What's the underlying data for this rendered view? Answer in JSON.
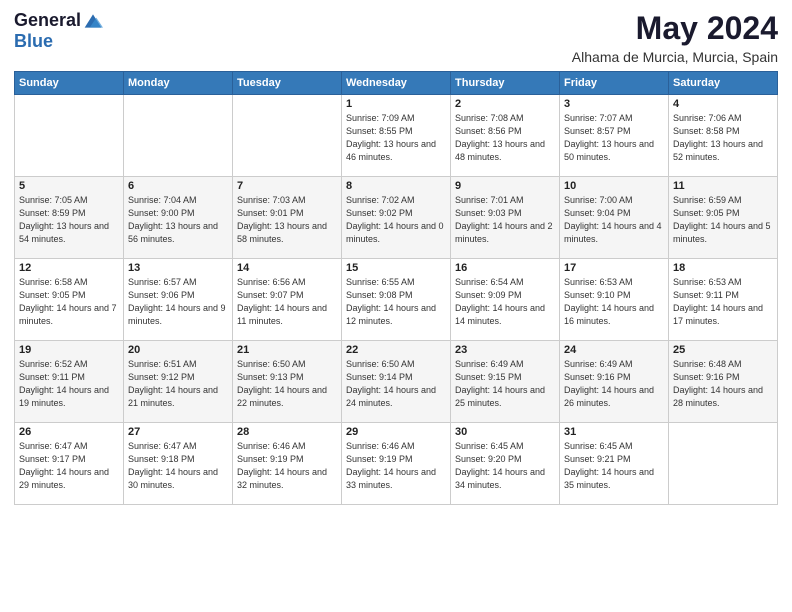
{
  "logo": {
    "general": "General",
    "blue": "Blue"
  },
  "header": {
    "title": "May 2024",
    "subtitle": "Alhama de Murcia, Murcia, Spain"
  },
  "weekdays": [
    "Sunday",
    "Monday",
    "Tuesday",
    "Wednesday",
    "Thursday",
    "Friday",
    "Saturday"
  ],
  "weeks": [
    [
      {
        "day": "",
        "sunrise": "",
        "sunset": "",
        "daylight": ""
      },
      {
        "day": "",
        "sunrise": "",
        "sunset": "",
        "daylight": ""
      },
      {
        "day": "",
        "sunrise": "",
        "sunset": "",
        "daylight": ""
      },
      {
        "day": "1",
        "sunrise": "Sunrise: 7:09 AM",
        "sunset": "Sunset: 8:55 PM",
        "daylight": "Daylight: 13 hours and 46 minutes."
      },
      {
        "day": "2",
        "sunrise": "Sunrise: 7:08 AM",
        "sunset": "Sunset: 8:56 PM",
        "daylight": "Daylight: 13 hours and 48 minutes."
      },
      {
        "day": "3",
        "sunrise": "Sunrise: 7:07 AM",
        "sunset": "Sunset: 8:57 PM",
        "daylight": "Daylight: 13 hours and 50 minutes."
      },
      {
        "day": "4",
        "sunrise": "Sunrise: 7:06 AM",
        "sunset": "Sunset: 8:58 PM",
        "daylight": "Daylight: 13 hours and 52 minutes."
      }
    ],
    [
      {
        "day": "5",
        "sunrise": "Sunrise: 7:05 AM",
        "sunset": "Sunset: 8:59 PM",
        "daylight": "Daylight: 13 hours and 54 minutes."
      },
      {
        "day": "6",
        "sunrise": "Sunrise: 7:04 AM",
        "sunset": "Sunset: 9:00 PM",
        "daylight": "Daylight: 13 hours and 56 minutes."
      },
      {
        "day": "7",
        "sunrise": "Sunrise: 7:03 AM",
        "sunset": "Sunset: 9:01 PM",
        "daylight": "Daylight: 13 hours and 58 minutes."
      },
      {
        "day": "8",
        "sunrise": "Sunrise: 7:02 AM",
        "sunset": "Sunset: 9:02 PM",
        "daylight": "Daylight: 14 hours and 0 minutes."
      },
      {
        "day": "9",
        "sunrise": "Sunrise: 7:01 AM",
        "sunset": "Sunset: 9:03 PM",
        "daylight": "Daylight: 14 hours and 2 minutes."
      },
      {
        "day": "10",
        "sunrise": "Sunrise: 7:00 AM",
        "sunset": "Sunset: 9:04 PM",
        "daylight": "Daylight: 14 hours and 4 minutes."
      },
      {
        "day": "11",
        "sunrise": "Sunrise: 6:59 AM",
        "sunset": "Sunset: 9:05 PM",
        "daylight": "Daylight: 14 hours and 5 minutes."
      }
    ],
    [
      {
        "day": "12",
        "sunrise": "Sunrise: 6:58 AM",
        "sunset": "Sunset: 9:05 PM",
        "daylight": "Daylight: 14 hours and 7 minutes."
      },
      {
        "day": "13",
        "sunrise": "Sunrise: 6:57 AM",
        "sunset": "Sunset: 9:06 PM",
        "daylight": "Daylight: 14 hours and 9 minutes."
      },
      {
        "day": "14",
        "sunrise": "Sunrise: 6:56 AM",
        "sunset": "Sunset: 9:07 PM",
        "daylight": "Daylight: 14 hours and 11 minutes."
      },
      {
        "day": "15",
        "sunrise": "Sunrise: 6:55 AM",
        "sunset": "Sunset: 9:08 PM",
        "daylight": "Daylight: 14 hours and 12 minutes."
      },
      {
        "day": "16",
        "sunrise": "Sunrise: 6:54 AM",
        "sunset": "Sunset: 9:09 PM",
        "daylight": "Daylight: 14 hours and 14 minutes."
      },
      {
        "day": "17",
        "sunrise": "Sunrise: 6:53 AM",
        "sunset": "Sunset: 9:10 PM",
        "daylight": "Daylight: 14 hours and 16 minutes."
      },
      {
        "day": "18",
        "sunrise": "Sunrise: 6:53 AM",
        "sunset": "Sunset: 9:11 PM",
        "daylight": "Daylight: 14 hours and 17 minutes."
      }
    ],
    [
      {
        "day": "19",
        "sunrise": "Sunrise: 6:52 AM",
        "sunset": "Sunset: 9:11 PM",
        "daylight": "Daylight: 14 hours and 19 minutes."
      },
      {
        "day": "20",
        "sunrise": "Sunrise: 6:51 AM",
        "sunset": "Sunset: 9:12 PM",
        "daylight": "Daylight: 14 hours and 21 minutes."
      },
      {
        "day": "21",
        "sunrise": "Sunrise: 6:50 AM",
        "sunset": "Sunset: 9:13 PM",
        "daylight": "Daylight: 14 hours and 22 minutes."
      },
      {
        "day": "22",
        "sunrise": "Sunrise: 6:50 AM",
        "sunset": "Sunset: 9:14 PM",
        "daylight": "Daylight: 14 hours and 24 minutes."
      },
      {
        "day": "23",
        "sunrise": "Sunrise: 6:49 AM",
        "sunset": "Sunset: 9:15 PM",
        "daylight": "Daylight: 14 hours and 25 minutes."
      },
      {
        "day": "24",
        "sunrise": "Sunrise: 6:49 AM",
        "sunset": "Sunset: 9:16 PM",
        "daylight": "Daylight: 14 hours and 26 minutes."
      },
      {
        "day": "25",
        "sunrise": "Sunrise: 6:48 AM",
        "sunset": "Sunset: 9:16 PM",
        "daylight": "Daylight: 14 hours and 28 minutes."
      }
    ],
    [
      {
        "day": "26",
        "sunrise": "Sunrise: 6:47 AM",
        "sunset": "Sunset: 9:17 PM",
        "daylight": "Daylight: 14 hours and 29 minutes."
      },
      {
        "day": "27",
        "sunrise": "Sunrise: 6:47 AM",
        "sunset": "Sunset: 9:18 PM",
        "daylight": "Daylight: 14 hours and 30 minutes."
      },
      {
        "day": "28",
        "sunrise": "Sunrise: 6:46 AM",
        "sunset": "Sunset: 9:19 PM",
        "daylight": "Daylight: 14 hours and 32 minutes."
      },
      {
        "day": "29",
        "sunrise": "Sunrise: 6:46 AM",
        "sunset": "Sunset: 9:19 PM",
        "daylight": "Daylight: 14 hours and 33 minutes."
      },
      {
        "day": "30",
        "sunrise": "Sunrise: 6:45 AM",
        "sunset": "Sunset: 9:20 PM",
        "daylight": "Daylight: 14 hours and 34 minutes."
      },
      {
        "day": "31",
        "sunrise": "Sunrise: 6:45 AM",
        "sunset": "Sunset: 9:21 PM",
        "daylight": "Daylight: 14 hours and 35 minutes."
      },
      {
        "day": "",
        "sunrise": "",
        "sunset": "",
        "daylight": ""
      }
    ]
  ]
}
